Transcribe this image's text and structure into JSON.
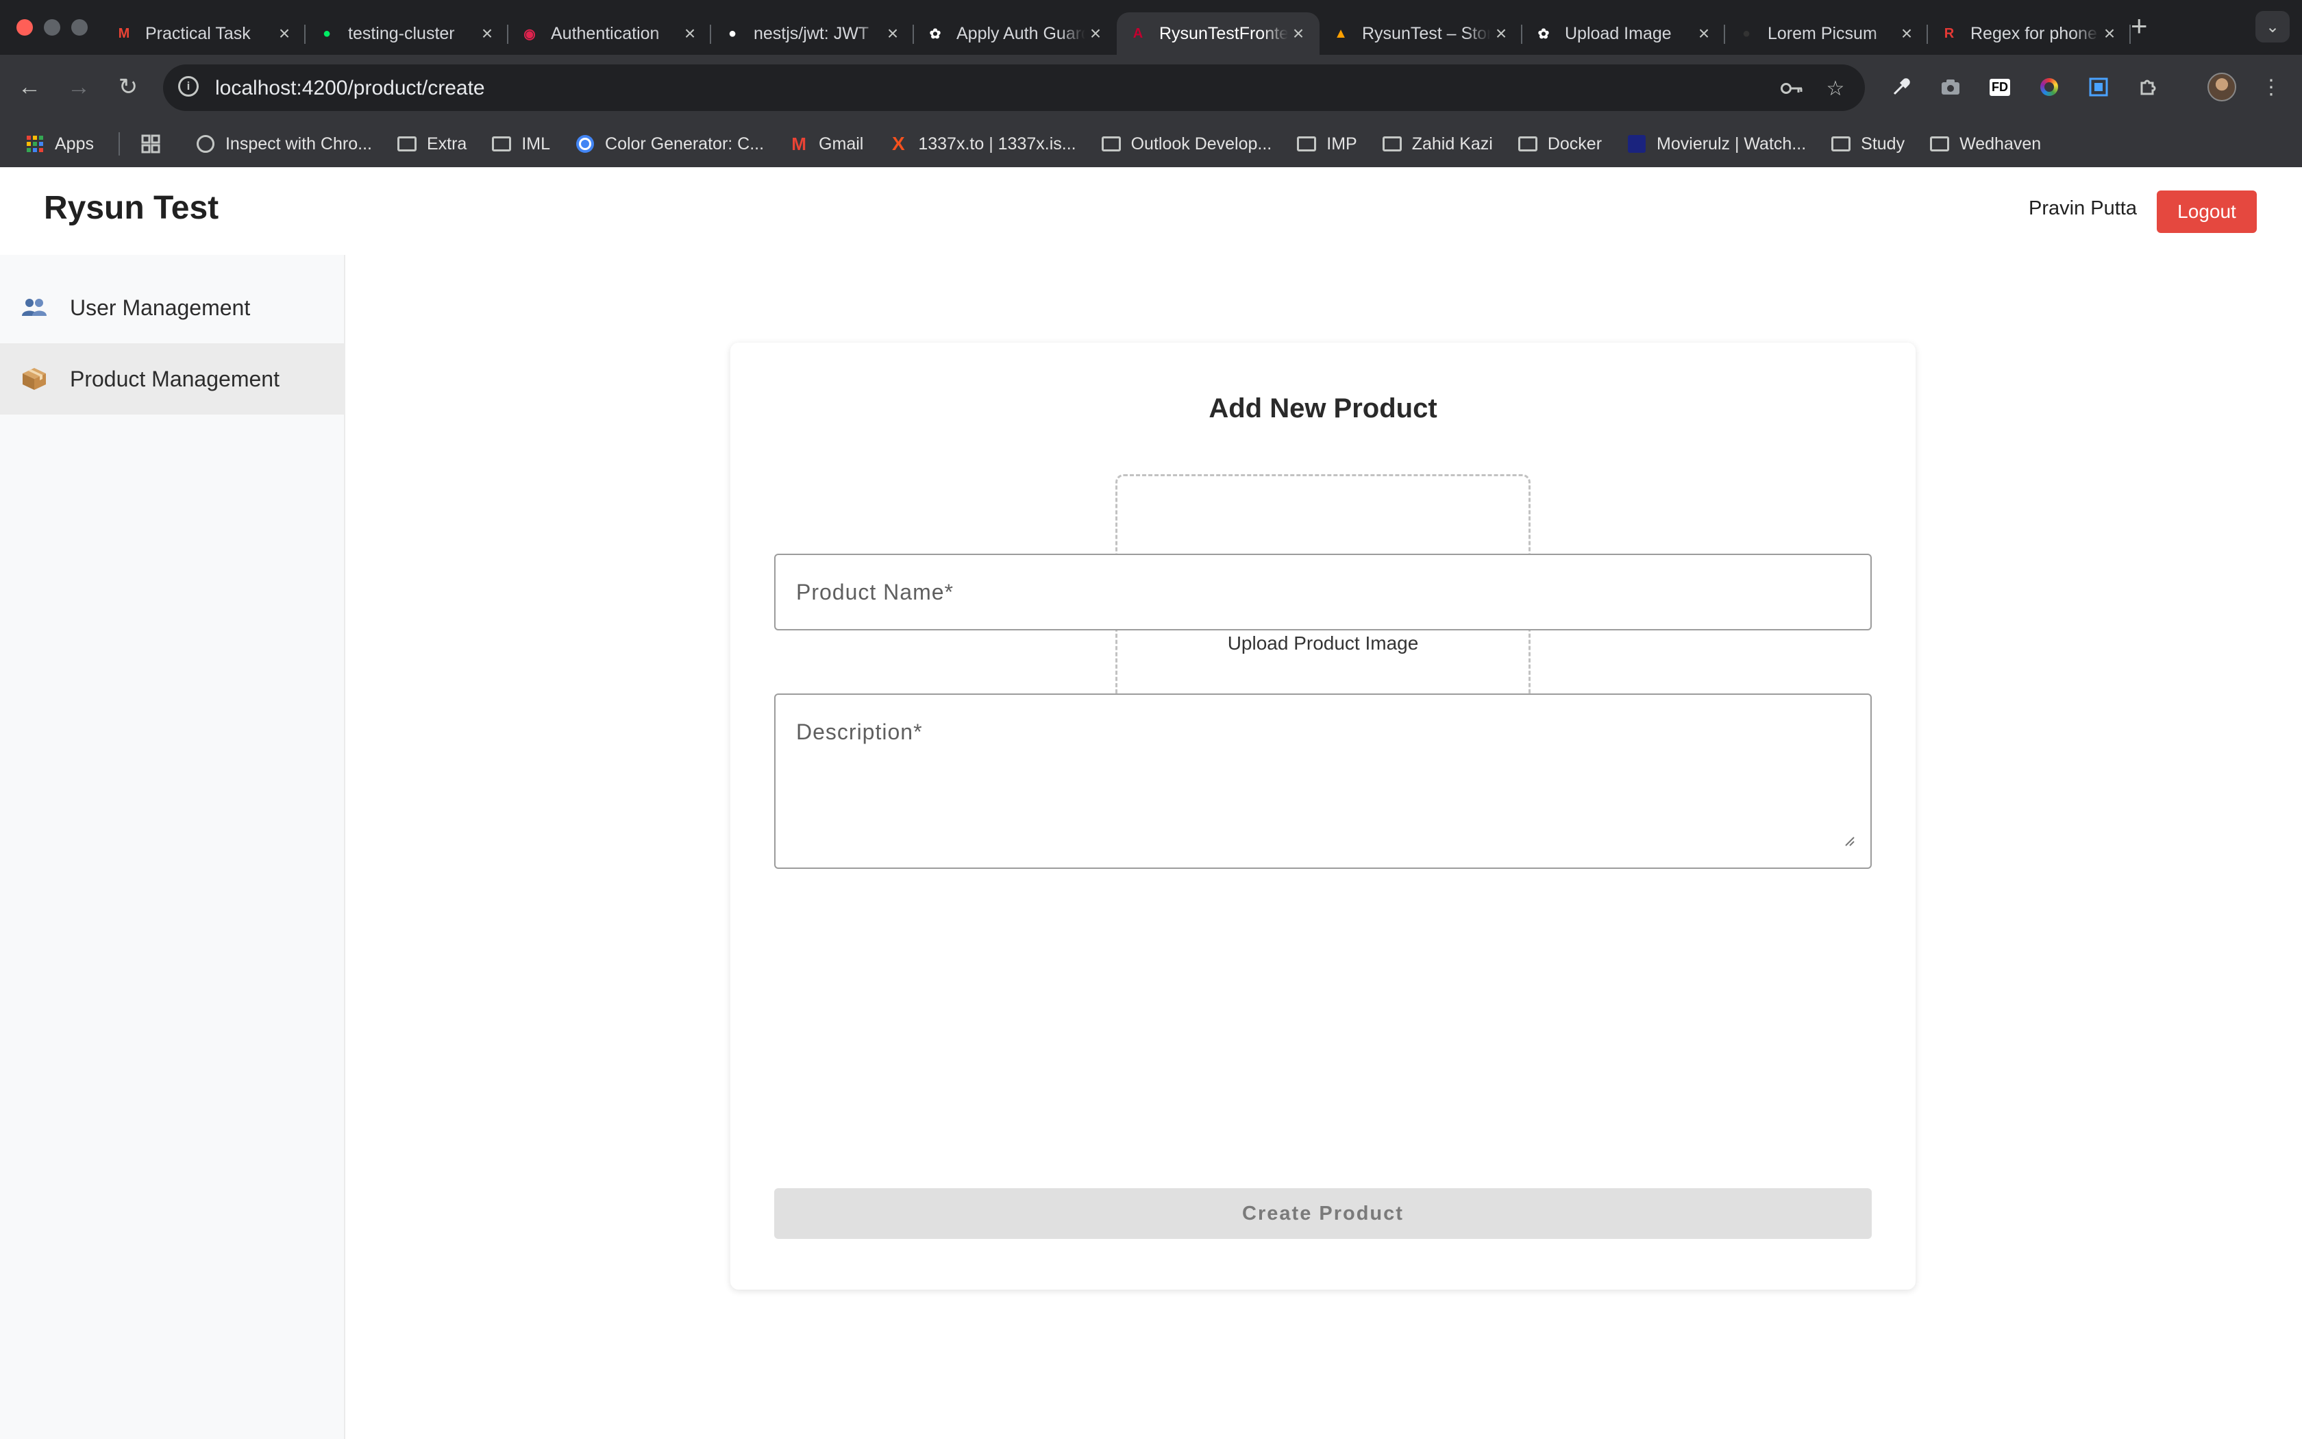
{
  "browser": {
    "tabs": [
      {
        "title": "Practical Task",
        "icon": "gmail-icon",
        "color": "#ea4335",
        "glyph": "M"
      },
      {
        "title": "testing-cluster",
        "icon": "mongodb-leaf-icon",
        "color": "#00ed64",
        "glyph": "●"
      },
      {
        "title": "Authentication",
        "icon": "nestjs-icon",
        "color": "#e0234e",
        "glyph": "◉"
      },
      {
        "title": "nestjs/jwt: JWT",
        "icon": "github-icon",
        "color": "#ffffff",
        "glyph": "●"
      },
      {
        "title": "Apply Auth Guard",
        "icon": "chatgpt-icon",
        "color": "#ffffff",
        "glyph": "✿"
      },
      {
        "title": "RysunTestFrontend",
        "icon": "angular-icon",
        "color": "#c3002f",
        "glyph": "A",
        "active": true
      },
      {
        "title": "RysunTest – Storage",
        "icon": "firebase-icon",
        "color": "#ffa000",
        "glyph": "▲"
      },
      {
        "title": "Upload Image",
        "icon": "chatgpt-icon",
        "color": "#ffffff",
        "glyph": "✿"
      },
      {
        "title": "Lorem Picsum",
        "icon": "picsum-icon",
        "color": "#333333",
        "glyph": "●"
      },
      {
        "title": "Regex for phone",
        "icon": "regex-r-icon",
        "color": "#e53935",
        "glyph": "R"
      }
    ],
    "url": "localhost:4200/product/create",
    "bookmarks": [
      {
        "label": "Apps",
        "type": "apps"
      },
      {
        "label": "",
        "type": "grid"
      },
      {
        "label": "Inspect with Chro...",
        "type": "globe"
      },
      {
        "label": "Extra",
        "type": "folder"
      },
      {
        "label": "IML",
        "type": "folder"
      },
      {
        "label": "Color Generator: C...",
        "type": "colorgen"
      },
      {
        "label": "Gmail",
        "type": "gmail"
      },
      {
        "label": "1337x.to | 1337x.is...",
        "type": "x"
      },
      {
        "label": "Outlook Develop...",
        "type": "folder"
      },
      {
        "label": "IMP",
        "type": "folder"
      },
      {
        "label": "Zahid Kazi",
        "type": "folder"
      },
      {
        "label": "Docker",
        "type": "folder"
      },
      {
        "label": "Movierulz | Watch...",
        "type": "movierulz"
      },
      {
        "label": "Study",
        "type": "folder"
      },
      {
        "label": "Wedhaven",
        "type": "folder"
      }
    ]
  },
  "app": {
    "brand": "Rysun Test",
    "user_name": "Pravin Putta",
    "logout_label": "Logout",
    "sidebar": [
      {
        "label": "User Management",
        "icon": "users-icon",
        "active": false
      },
      {
        "label": "Product Management",
        "icon": "package-icon",
        "active": true
      }
    ],
    "form": {
      "title": "Add New Product",
      "upload_label": "Upload Product Image",
      "product_name_label": "Product Name*",
      "description_label": "Description*",
      "submit_label": "Create Product"
    }
  },
  "colors": {
    "logout": "#e5483f",
    "active_sidebar": "#ebebeb",
    "button_disabled": "#e0e0e0"
  }
}
